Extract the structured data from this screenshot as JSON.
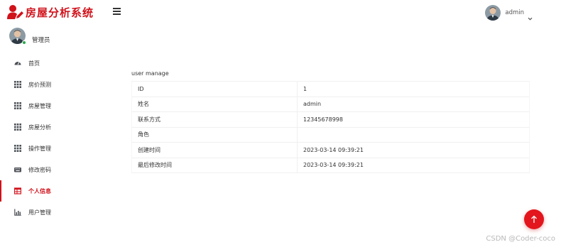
{
  "app": {
    "title": "房屋分析系统",
    "accent_color": "#d0121b"
  },
  "header": {
    "menu_toggle_icon": "hamburger-icon",
    "user_name": "admin",
    "dropdown_icon": "chevron-down-icon"
  },
  "sidebar": {
    "profile_name": "管理员",
    "items": [
      {
        "label": "首页",
        "icon": "dashboard-icon"
      },
      {
        "label": "房价预测",
        "icon": "grid-icon"
      },
      {
        "label": "房屋管理",
        "icon": "grid-icon"
      },
      {
        "label": "房屋分析",
        "icon": "grid-icon"
      },
      {
        "label": "操作管理",
        "icon": "grid-icon"
      },
      {
        "label": "修改密码",
        "icon": "keyboard-icon"
      },
      {
        "label": "个人信息",
        "icon": "table-icon",
        "active": true
      },
      {
        "label": "用户管理",
        "icon": "chart-icon"
      }
    ]
  },
  "main": {
    "section_title": "user manage",
    "rows": [
      {
        "key": "ID",
        "value": "1"
      },
      {
        "key": "姓名",
        "value": "admin"
      },
      {
        "key": "联系方式",
        "value": "12345678998"
      },
      {
        "key": "角色",
        "value": ""
      },
      {
        "key": "创建时间",
        "value": "2023-03-14 09:39:21"
      },
      {
        "key": "最后修改时间",
        "value": "2023-03-14 09:39:21"
      }
    ]
  },
  "fab_icon": "arrow-up-icon",
  "watermark": "CSDN @Coder-coco"
}
